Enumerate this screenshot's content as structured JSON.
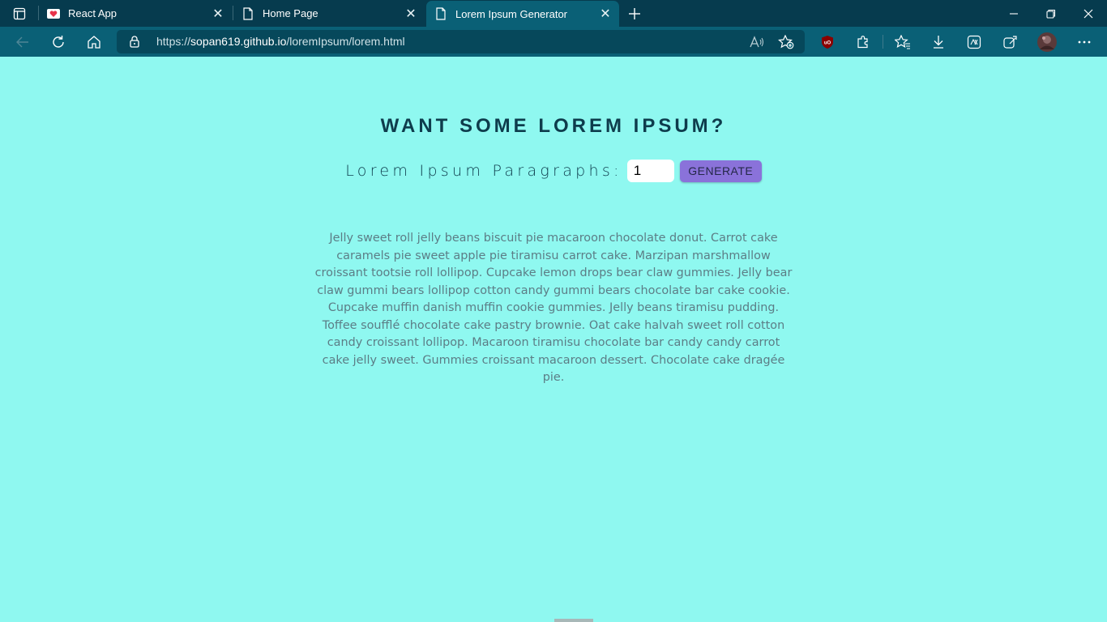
{
  "browser": {
    "tabs": [
      {
        "title": "React App",
        "favicon": "heart-icon",
        "active": false
      },
      {
        "title": "Home Page",
        "favicon": "page-icon",
        "active": false
      },
      {
        "title": "Lorem Ipsum Generator",
        "favicon": "page-icon",
        "active": true
      }
    ],
    "url_prefix": "https://",
    "url_host": "sopan619.github.io",
    "url_path": "/loremIpsum/lorem.html",
    "colors": {
      "tabbar": "#063b4e",
      "toolbar": "#0a6076",
      "page_bg": "#8ff8f0"
    }
  },
  "page": {
    "heading": "WANT SOME LOREM IPSUM?",
    "label": "Lorem Ipsum Paragraphs:",
    "count_value": "1",
    "button_label": "GENERATE",
    "paragraph": "Jelly sweet roll jelly beans biscuit pie macaroon chocolate donut. Carrot cake caramels pie sweet apple pie tiramisu carrot cake. Marzipan marshmallow croissant tootsie roll lollipop. Cupcake lemon drops bear claw gummies. Jelly bear claw gummi bears lollipop cotton candy gummi bears chocolate bar cake cookie. Cupcake muffin danish muffin cookie gummies. Jelly beans tiramisu pudding. Toffee soufflé chocolate cake pastry brownie. Oat cake halvah sweet roll cotton candy croissant lollipop. Macaroon tiramisu chocolate bar candy candy carrot cake jelly sweet. Gummies croissant macaroon dessert. Chocolate cake dragée pie.",
    "colors": {
      "heading": "#0e3c4c",
      "button": "#8a72da",
      "paragraph": "#5c7d86"
    }
  }
}
